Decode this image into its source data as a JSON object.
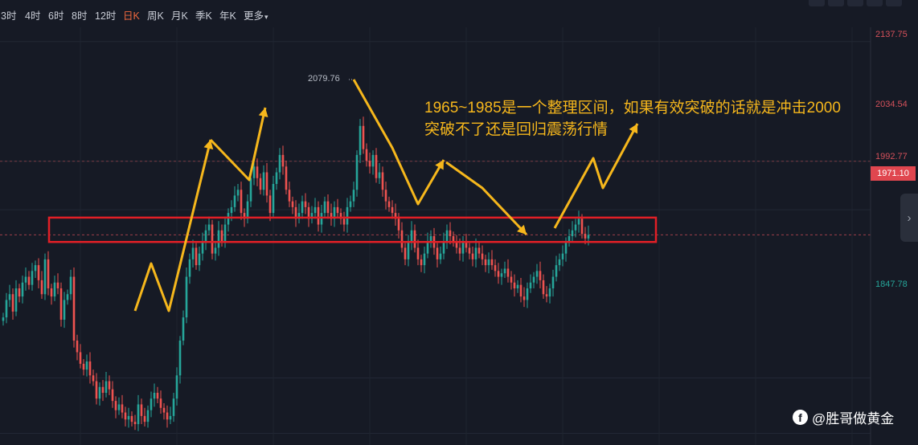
{
  "toolbar": {
    "timeframes": [
      "3时",
      "4时",
      "6时",
      "8时",
      "12时",
      "日K",
      "周K",
      "月K",
      "季K",
      "年K",
      "更多"
    ],
    "active": "日K",
    "more_caret": "▾"
  },
  "axis": {
    "y_labels": [
      "2137.75",
      "2034.54",
      "1992.77",
      "1847.78"
    ],
    "current_price": "1971.10",
    "colors": {
      "axis_text": "#d4505a",
      "axis_low": "#26a69a",
      "current_bg": "#e0464f",
      "up": "#26a69a",
      "down": "#ef5350"
    }
  },
  "annotations": {
    "high_label": "2079.76",
    "text_line1": "1965~1985是一个整理区间，如果有效突破的话就是冲击2000",
    "text_line2": "突破不了还是回归震荡行情",
    "range_box_color": "#e21f26",
    "arrow_color": "#f6b71c"
  },
  "watermark": {
    "icon": "facebook-icon",
    "text": "@胜哥做黄金"
  },
  "controls": {
    "scroll_right": "›"
  },
  "chart_data": {
    "type": "candlestick",
    "ylim": [
      1790,
      2150
    ],
    "range_zone": [
      1965,
      1985
    ],
    "series_close": [
      1900,
      1915,
      1920,
      1905,
      1925,
      1918,
      1930,
      1935,
      1928,
      1940,
      1945,
      1932,
      1920,
      1950,
      1925,
      1918,
      1930,
      1925,
      1898,
      1915,
      1920,
      1935,
      1880,
      1870,
      1860,
      1855,
      1862,
      1850,
      1845,
      1830,
      1840,
      1835,
      1845,
      1838,
      1828,
      1820,
      1825,
      1818,
      1812,
      1815,
      1810,
      1808,
      1825,
      1815,
      1810,
      1820,
      1830,
      1835,
      1830,
      1822,
      1818,
      1812,
      1815,
      1830,
      1850,
      1880,
      1900,
      1935,
      1950,
      1960,
      1945,
      1955,
      1965,
      1975,
      1980,
      1955,
      1960,
      1975,
      1965,
      1980,
      1990,
      1995,
      2005,
      2010,
      1990,
      1985,
      2000,
      2020,
      2030,
      2020,
      2010,
      2025,
      2005,
      1990,
      2015,
      2025,
      2040,
      2030,
      2010,
      2000,
      1995,
      1985,
      1990,
      2000,
      1995,
      1985,
      1990,
      1995,
      1980,
      1990,
      2000,
      1990,
      1985,
      1995,
      1990,
      1985,
      1980,
      1995,
      2000,
      2010,
      2040,
      2065,
      2045,
      2035,
      2030,
      2040,
      2020,
      2025,
      2010,
      2000,
      1995,
      1990,
      1985,
      1975,
      1960,
      1950,
      1965,
      1975,
      1960,
      1950,
      1945,
      1955,
      1965,
      1970,
      1960,
      1950,
      1955,
      1965,
      1975,
      1970,
      1965,
      1960,
      1955,
      1965,
      1960,
      1955,
      1950,
      1960,
      1955,
      1950,
      1945,
      1950,
      1945,
      1940,
      1935,
      1938,
      1942,
      1935,
      1930,
      1925,
      1928,
      1918,
      1915,
      1925,
      1930,
      1935,
      1940,
      1932,
      1920,
      1918,
      1925,
      1935,
      1945,
      1950,
      1955,
      1965,
      1970,
      1975,
      1980,
      1985,
      1972,
      1968,
      1971.1
    ],
    "high": 2079.76
  }
}
